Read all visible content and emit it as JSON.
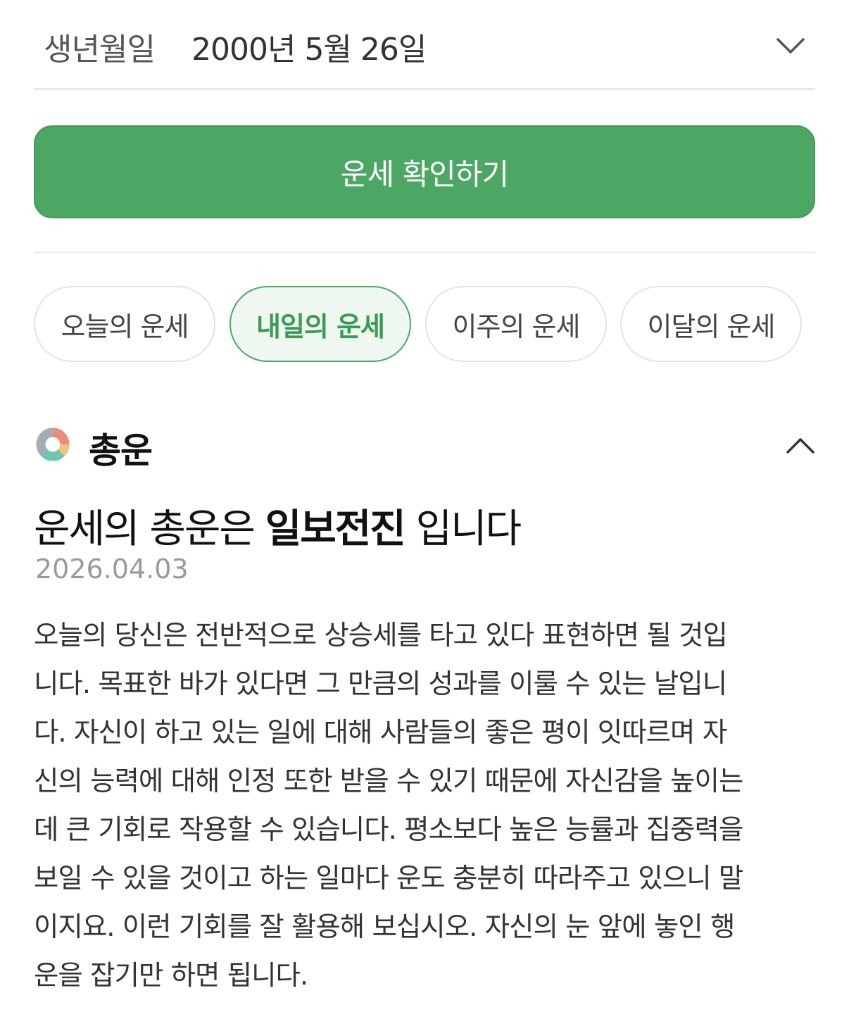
{
  "birth": {
    "label": "생년월일",
    "value": "2000년 5월 26일",
    "icon": "chevron-down-icon"
  },
  "check_button": {
    "label": "운세 확인하기",
    "color": "#4ba763"
  },
  "tabs": [
    {
      "label": "오늘의 운세",
      "active": false
    },
    {
      "label": "내일의 운세",
      "active": true
    },
    {
      "label": "이주의 운세",
      "active": false
    },
    {
      "label": "이달의 운세",
      "active": false
    }
  ],
  "section": {
    "title": "총운",
    "icon": "donut-chart-icon",
    "toggle_icon": "chevron-up-icon"
  },
  "fortune": {
    "headline_prefix": "운세의 총운은",
    "headline_keyword": "일보전진",
    "headline_suffix": "입니다",
    "date": "2026.04.03",
    "body_lines": [
      "오늘의 당신은 전반적으로 상승세를 타고 있다 표현하면 될 것입",
      "니다. 목표한 바가 있다면 그 만큼의 성과를 이룰 수 있는 날입니",
      "다. 자신이 하고 있는 일에 대해 사람들의 좋은 평이 잇따르며 자",
      "신의 능력에 대해 인정 또한 받을 수 있기 때문에 자신감을 높이는",
      "데 큰 기회로 작용할 수 있습니다. 평소보다 높은 능률과 집중력을",
      "보일 수 있을 것이고 하는 일마다 운도 충분히 따라주고 있으니 말",
      "이지요. 이런 기회를 잘 활용해 보십시오. 자신의 눈 앞에 놓인 행",
      "운을 잡기만 하면 됩니다."
    ]
  }
}
